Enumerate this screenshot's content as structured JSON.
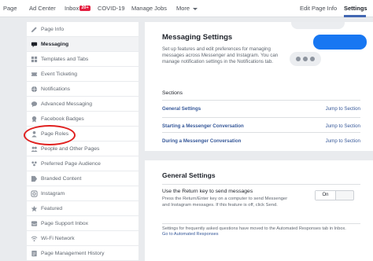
{
  "topnav": {
    "page": "Page",
    "ad_center": "Ad Center",
    "inbox": "Inbox",
    "inbox_badge": "20+",
    "covid": "COVID-19",
    "manage_jobs": "Manage Jobs",
    "more": "More",
    "edit_page_info": "Edit Page Info",
    "settings": "Settings"
  },
  "sidebar": {
    "items": [
      {
        "label": "Page Info",
        "icon": "pencil-icon"
      },
      {
        "label": "Messaging",
        "icon": "chat-icon"
      },
      {
        "label": "Templates and Tabs",
        "icon": "grid-icon"
      },
      {
        "label": "Event Ticketing",
        "icon": "ticket-icon"
      },
      {
        "label": "Notifications",
        "icon": "globe-icon"
      },
      {
        "label": "Advanced Messaging",
        "icon": "chat-bubble-icon"
      },
      {
        "label": "Facebook Badges",
        "icon": "badge-icon"
      },
      {
        "label": "Page Roles",
        "icon": "person-icon"
      },
      {
        "label": "People and Other Pages",
        "icon": "people-icon"
      },
      {
        "label": "Preferred Page Audience",
        "icon": "audience-icon"
      },
      {
        "label": "Branded Content",
        "icon": "branded-content-icon"
      },
      {
        "label": "Instagram",
        "icon": "instagram-icon"
      },
      {
        "label": "Featured",
        "icon": "star-icon"
      },
      {
        "label": "Page Support Inbox",
        "icon": "inbox-icon"
      },
      {
        "label": "Wi-Fi Network",
        "icon": "wifi-icon"
      },
      {
        "label": "Page Management History",
        "icon": "history-icon"
      }
    ]
  },
  "messaging": {
    "title": "Messaging Settings",
    "description": "Set up features and edit preferences for managing messages across Messenger and Instagram. You can manage notification settings in the Notifications tab.",
    "sections_label": "Sections",
    "sections": [
      {
        "name": "General Settings",
        "link": "Jump to Section"
      },
      {
        "name": "Starting a Messenger Conversation",
        "link": "Jump to Section"
      },
      {
        "name": "During a Messenger Conversation",
        "link": "Jump to Section"
      }
    ]
  },
  "general": {
    "title": "General Settings",
    "label": "Use the Return key to send messages",
    "description": "Press the Return/Enter key on a computer to send Messenger and Instagram messages. If this feature is off, click Send.",
    "toggle_on": "On",
    "note": "Settings for frequently asked questions have moved to the Automated Responses tab in Inbox.",
    "note_link": "Go to Automated Responses"
  },
  "colors": {
    "accent": "#1877f2",
    "link": "#365899",
    "highlight_ring": "#e0201f",
    "badge": "#e41e3f"
  }
}
